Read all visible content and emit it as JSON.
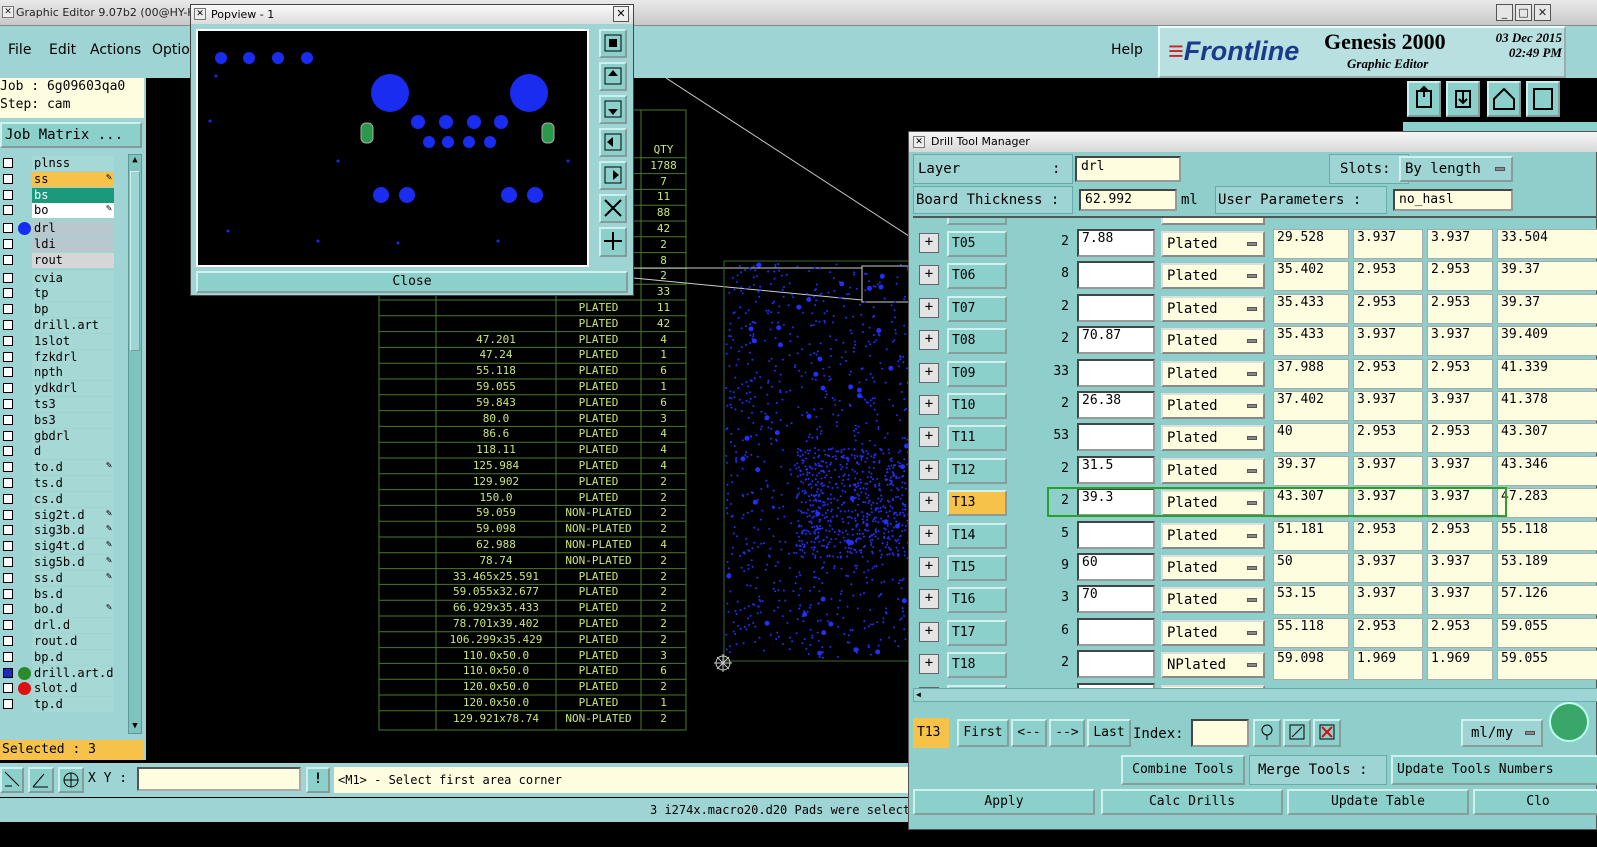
{
  "main": {
    "title": "Graphic Editor 9.07b2 (00@HY-H",
    "menu": {
      "file": "File",
      "edit": "Edit",
      "actions": "Actions",
      "options": "Option",
      "help": "Help"
    }
  },
  "brand": {
    "logo": "Frontline",
    "product": "Genesis 2000",
    "subtitle": "Graphic Editor",
    "date": "03 Dec 2015",
    "time": "02:49 PM"
  },
  "left": {
    "job": "Job : 6g09603qa0",
    "step": "Step: cam",
    "job_matrix": "Job Matrix ...",
    "layers": [
      {
        "name": "plnss",
        "color": "#a6d8d6"
      },
      {
        "name": "ss",
        "color": "#f6c24a",
        "mark": "✎"
      },
      {
        "name": "bs",
        "color": "#1a9a7a"
      },
      {
        "name": "bo",
        "color": "#ffffff",
        "mark": "✎"
      },
      {
        "name": "drl",
        "color": "#b8c8cc",
        "dot": "#1a2cf0"
      },
      {
        "name": "ldi",
        "color": "#b8c8cc"
      },
      {
        "name": "rout",
        "color": "#d6d6d6"
      },
      {
        "name": "cvia"
      },
      {
        "name": "tp"
      },
      {
        "name": "bp"
      },
      {
        "name": "drill.art"
      },
      {
        "name": "1slot"
      },
      {
        "name": "fzkdrl"
      },
      {
        "name": "npth"
      },
      {
        "name": "ydkdrl"
      },
      {
        "name": "ts3"
      },
      {
        "name": "bs3"
      },
      {
        "name": "gbdrl"
      },
      {
        "name": "d"
      },
      {
        "name": "to.d",
        "mark": "✎"
      },
      {
        "name": "ts.d"
      },
      {
        "name": "cs.d"
      },
      {
        "name": "sig2t.d",
        "mark": "✎"
      },
      {
        "name": "sig3b.d",
        "mark": "✎"
      },
      {
        "name": "sig4t.d",
        "mark": "✎"
      },
      {
        "name": "sig5b.d",
        "mark": "✎"
      },
      {
        "name": "ss.d",
        "mark": "✎"
      },
      {
        "name": "bs.d"
      },
      {
        "name": "bo.d",
        "mark": "✎"
      },
      {
        "name": "drl.d"
      },
      {
        "name": "rout.d"
      },
      {
        "name": "bp.d"
      },
      {
        "name": "drill.art.d",
        "dot": "#2a8a2a",
        "checked": true
      },
      {
        "name": "slot.d",
        "dot": "#e01010"
      },
      {
        "name": "tp.d"
      }
    ],
    "selected": "Selected : 3"
  },
  "bottom": {
    "xy_label": "X Y :",
    "xy_value": "",
    "prompt": "<M1> - Select first area corner",
    "status": "3 i274x.macro20.d20 Pads were selected"
  },
  "drill_table": {
    "header": "QTY",
    "rows": [
      [
        "",
        "",
        "1788"
      ],
      [
        "",
        "",
        "7"
      ],
      [
        "",
        "",
        "11"
      ],
      [
        "",
        "",
        "88"
      ],
      [
        "",
        "",
        "42"
      ],
      [
        "",
        "",
        "2"
      ],
      [
        "",
        "",
        "8"
      ],
      [
        "",
        "",
        "2"
      ],
      [
        "",
        "",
        "33"
      ],
      [
        "",
        "PLATED",
        "11"
      ],
      [
        "",
        "PLATED",
        "42"
      ],
      [
        "47.201",
        "PLATED",
        "4"
      ],
      [
        "47.24",
        "PLATED",
        "1"
      ],
      [
        "55.118",
        "PLATED",
        "6"
      ],
      [
        "59.055",
        "PLATED",
        "1"
      ],
      [
        "59.843",
        "PLATED",
        "6"
      ],
      [
        "80.0",
        "PLATED",
        "3"
      ],
      [
        "86.6",
        "PLATED",
        "4"
      ],
      [
        "118.11",
        "PLATED",
        "4"
      ],
      [
        "125.984",
        "PLATED",
        "4"
      ],
      [
        "129.902",
        "PLATED",
        "2"
      ],
      [
        "150.0",
        "PLATED",
        "2"
      ],
      [
        "59.059",
        "NON-PLATED",
        "2"
      ],
      [
        "59.098",
        "NON-PLATED",
        "2"
      ],
      [
        "62.988",
        "NON-PLATED",
        "4"
      ],
      [
        "78.74",
        "NON-PLATED",
        "2"
      ],
      [
        "33.465x25.591",
        "PLATED",
        "2"
      ],
      [
        "59.055x32.677",
        "PLATED",
        "2"
      ],
      [
        "66.929x35.433",
        "PLATED",
        "2"
      ],
      [
        "78.701x39.402",
        "PLATED",
        "2"
      ],
      [
        "106.299x35.429",
        "PLATED",
        "2"
      ],
      [
        "110.0x50.0",
        "PLATED",
        "3"
      ],
      [
        "110.0x50.0",
        "PLATED",
        "6"
      ],
      [
        "120.0x50.0",
        "PLATED",
        "2"
      ],
      [
        "120.0x50.0",
        "PLATED",
        "1"
      ],
      [
        "129.921x78.74",
        "NON-PLATED",
        "2"
      ]
    ]
  },
  "popview": {
    "title": "Popview - 1",
    "close": "Close"
  },
  "dtm": {
    "title": "Drill Tool Manager",
    "layer_label": "Layer",
    "layer_colon": ":",
    "layer_value": "drl",
    "slots_label": "Slots:",
    "slots_value": "By length",
    "board_thickness_label": "Board Thickness :",
    "board_thickness_value": "62.992",
    "board_thickness_unit": "ml",
    "user_params_label": "User Parameters :",
    "user_params_value": "no_hasl",
    "rows": [
      {
        "tool": "T05",
        "count": "2",
        "dia": "7.88",
        "type": "Plated",
        "c1": "29.528",
        "c2": "3.937",
        "c3": "3.937",
        "c4": "33.504"
      },
      {
        "tool": "T06",
        "count": "8",
        "dia": "",
        "type": "Plated",
        "c1": "35.402",
        "c2": "2.953",
        "c3": "2.953",
        "c4": "39.37"
      },
      {
        "tool": "T07",
        "count": "2",
        "dia": "",
        "type": "Plated",
        "c1": "35.433",
        "c2": "2.953",
        "c3": "2.953",
        "c4": "39.37"
      },
      {
        "tool": "T08",
        "count": "2",
        "dia": "70.87",
        "type": "Plated",
        "c1": "35.433",
        "c2": "3.937",
        "c3": "3.937",
        "c4": "39.409"
      },
      {
        "tool": "T09",
        "count": "33",
        "dia": "",
        "type": "Plated",
        "c1": "37.988",
        "c2": "2.953",
        "c3": "2.953",
        "c4": "41.339"
      },
      {
        "tool": "T10",
        "count": "2",
        "dia": "26.38",
        "type": "Plated",
        "c1": "37.402",
        "c2": "3.937",
        "c3": "3.937",
        "c4": "41.378"
      },
      {
        "tool": "T11",
        "count": "53",
        "dia": "",
        "type": "Plated",
        "c1": "40",
        "c2": "2.953",
        "c3": "2.953",
        "c4": "43.307"
      },
      {
        "tool": "T12",
        "count": "2",
        "dia": "31.5",
        "type": "Plated",
        "c1": "39.37",
        "c2": "3.937",
        "c3": "3.937",
        "c4": "43.346"
      },
      {
        "tool": "T13",
        "count": "2",
        "dia": "39.3",
        "type": "Plated",
        "c1": "43.307",
        "c2": "3.937",
        "c3": "3.937",
        "c4": "47.283",
        "selected": true
      },
      {
        "tool": "T14",
        "count": "5",
        "dia": "",
        "type": "Plated",
        "c1": "51.181",
        "c2": "2.953",
        "c3": "2.953",
        "c4": "55.118"
      },
      {
        "tool": "T15",
        "count": "9",
        "dia": "60",
        "type": "Plated",
        "c1": "50",
        "c2": "3.937",
        "c3": "3.937",
        "c4": "53.189"
      },
      {
        "tool": "T16",
        "count": "3",
        "dia": "70",
        "type": "Plated",
        "c1": "53.15",
        "c2": "3.937",
        "c3": "3.937",
        "c4": "57.126"
      },
      {
        "tool": "T17",
        "count": "6",
        "dia": "",
        "type": "Plated",
        "c1": "55.118",
        "c2": "2.953",
        "c3": "2.953",
        "c4": "59.055"
      },
      {
        "tool": "T18",
        "count": "2",
        "dia": "",
        "type": "NPlated",
        "c1": "59.098",
        "c2": "1.969",
        "c3": "1.969",
        "c4": "59.055"
      }
    ],
    "current_tool": "T13",
    "nav": {
      "first": "First",
      "prev": "<--",
      "next": "-->",
      "last": "Last",
      "index": "Index:"
    },
    "units": "ml/my",
    "combine_tools": "Combine Tools",
    "merge_tools": "Merge Tools :",
    "update_tools_numbers": "Update Tools Numbers",
    "apply": "Apply",
    "calc_drills": "Calc Drills",
    "update_table": "Update Table",
    "close": "Clo"
  }
}
